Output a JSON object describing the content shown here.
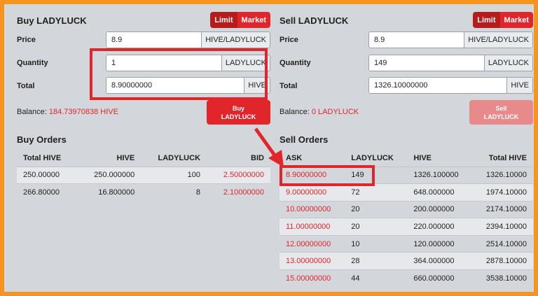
{
  "colors": {
    "accent": "#e1262b",
    "frame": "#f7941d",
    "background": "#d3d6da"
  },
  "buy": {
    "title": "Buy LADYLUCK",
    "toggle": {
      "limit": "Limit",
      "market": "Market"
    },
    "price": {
      "label": "Price",
      "value": "8.9",
      "unit": "HIVE/LADYLUCK"
    },
    "quantity": {
      "label": "Quantity",
      "value": "1",
      "unit": "LADYLUCK"
    },
    "total": {
      "label": "Total",
      "value": "8.90000000",
      "unit": "HIVE"
    },
    "balance": {
      "label": "Balance:",
      "value": "184.73970838 HIVE"
    },
    "button": {
      "line1": "Buy",
      "line2": "LADYLUCK"
    }
  },
  "sell": {
    "title": "Sell LADYLUCK",
    "toggle": {
      "limit": "Limit",
      "market": "Market"
    },
    "price": {
      "label": "Price",
      "value": "8.9",
      "unit": "HIVE/LADYLUCK"
    },
    "quantity": {
      "label": "Quantity",
      "value": "149",
      "unit": "LADYLUCK"
    },
    "total": {
      "label": "Total",
      "value": "1326.10000000",
      "unit": "HIVE"
    },
    "balance": {
      "label": "Balance:",
      "value": "0 LADYLUCK"
    },
    "button": {
      "line1": "Sell",
      "line2": "LADYLUCK"
    }
  },
  "buy_orders": {
    "title": "Buy Orders",
    "headers": [
      "Total HIVE",
      "HIVE",
      "LADYLUCK",
      "BID"
    ],
    "rows": [
      [
        "250.00000",
        "250.000000",
        "100",
        "2.50000000"
      ],
      [
        "266.80000",
        "16.800000",
        "8",
        "2.10000000"
      ]
    ]
  },
  "sell_orders": {
    "title": "Sell Orders",
    "headers": [
      "ASK",
      "LADYLUCK",
      "HIVE",
      "Total HIVE"
    ],
    "rows": [
      [
        "8.90000000",
        "149",
        "1326.100000",
        "1326.10000"
      ],
      [
        "9.00000000",
        "72",
        "648.000000",
        "1974.10000"
      ],
      [
        "10.00000000",
        "20",
        "200.000000",
        "2174.10000"
      ],
      [
        "11.00000000",
        "20",
        "220.000000",
        "2394.10000"
      ],
      [
        "12.00000000",
        "10",
        "120.000000",
        "2514.10000"
      ],
      [
        "13.00000000",
        "28",
        "364.000000",
        "2878.10000"
      ],
      [
        "15.00000000",
        "44",
        "660.000000",
        "3538.10000"
      ]
    ]
  }
}
